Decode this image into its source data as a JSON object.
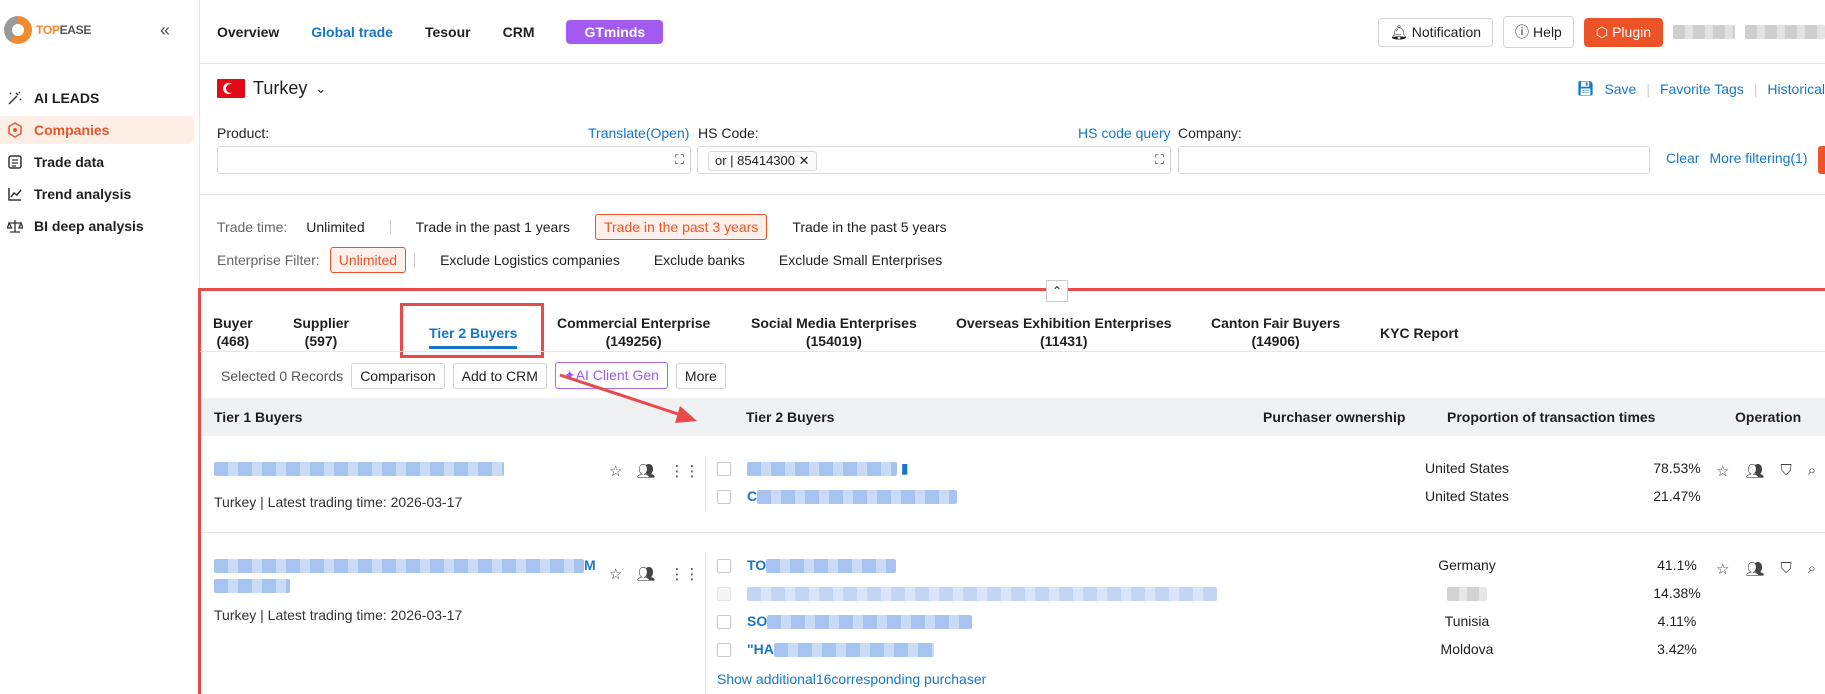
{
  "sidebar": {
    "logo_text": "TOPEASE",
    "items": [
      {
        "label": "AI LEADS",
        "icon": "ai-leads-icon"
      },
      {
        "label": "Companies",
        "icon": "companies-icon",
        "active": true
      },
      {
        "label": "Trade data",
        "icon": "trade-data-icon"
      },
      {
        "label": "Trend analysis",
        "icon": "trend-icon"
      },
      {
        "label": "BI deep analysis",
        "icon": "bi-scale-icon"
      }
    ]
  },
  "topbar": {
    "nav": [
      "Overview",
      "Global trade",
      "Tesour",
      "CRM"
    ],
    "gtminds": "GTminds",
    "notification": "Notification",
    "help": "Help",
    "plugin": "Plugin"
  },
  "filters": {
    "country": "Turkey",
    "save": "Save",
    "favorite_tags": "Favorite Tags",
    "historical": "Historical",
    "product_label": "Product:",
    "translate": "Translate(Open)",
    "hs_label": "HS Code:",
    "hs_query": "HS code query",
    "hs_tag": "or | 85414300",
    "company_label": "Company:",
    "clear": "Clear",
    "more_filtering": "More filtering(1)",
    "trade_time_label": "Trade time:",
    "trade_time_options": [
      "Unlimited",
      "Trade in the past 1 years",
      "Trade in the past 3 years",
      "Trade in the past 5 years"
    ],
    "trade_time_selected": 2,
    "enterprise_label": "Enterprise Filter:",
    "enterprise_options": [
      "Unlimited",
      "Exclude Logistics companies",
      "Exclude banks",
      "Exclude Small Enterprises"
    ],
    "enterprise_selected": 0
  },
  "tabs": [
    {
      "label": "Buyer",
      "count": "(468)"
    },
    {
      "label": "Supplier",
      "count": "(597)"
    },
    {
      "label": "Tier 2 Buyers",
      "count": ""
    },
    {
      "label": "Commercial Enterprise",
      "count": "(149256)"
    },
    {
      "label": "Social Media Enterprises",
      "count": "(154019)"
    },
    {
      "label": "Overseas Exhibition Enterprises",
      "count": "(11431)"
    },
    {
      "label": "Canton Fair Buyers",
      "count": "(14906)"
    },
    {
      "label": "KYC Report",
      "count": ""
    }
  ],
  "actions": {
    "selected": "Selected 0 Records",
    "comparison": "Comparison",
    "add_crm": "Add to CRM",
    "ai_client": "AI Client Gen",
    "more": "More"
  },
  "table": {
    "headers": {
      "tier1": "Tier 1 Buyers",
      "tier2": "Tier 2 Buyers",
      "ownership": "Purchaser ownership",
      "proportion": "Proportion of transaction times",
      "operation": "Operation"
    },
    "rows": [
      {
        "meta": "Turkey | Latest trading time:  2026-03-17",
        "subs": [
          {
            "name": "",
            "owner": "United States",
            "prop": "78.53%"
          },
          {
            "name": "C",
            "owner": "United States",
            "prop": "21.47%"
          }
        ]
      },
      {
        "name_suffix": "M",
        "meta": "Turkey | Latest trading time:  2026-03-17",
        "subs": [
          {
            "name": "TO",
            "owner": "Germany",
            "prop": "41.1%"
          },
          {
            "name": "",
            "owner": "",
            "prop": "14.38%"
          },
          {
            "name": "SO",
            "owner": "Tunisia",
            "prop": "4.11%"
          },
          {
            "name": "\"HA",
            "owner": "Moldova",
            "prop": "3.42%"
          }
        ],
        "show_more": "Show additional16corresponding purchaser"
      }
    ]
  },
  "colors": {
    "accent": "#ec5427",
    "link": "#1677c7",
    "highlight": "#e84a4a",
    "gtminds": "#a25af0"
  }
}
